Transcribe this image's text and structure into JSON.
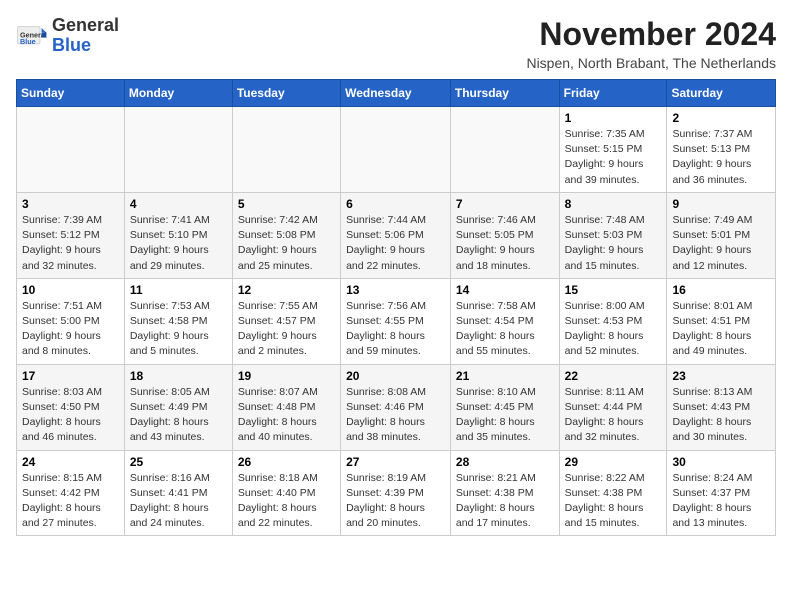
{
  "header": {
    "logo_general": "General",
    "logo_blue": "Blue",
    "month_title": "November 2024",
    "location": "Nispen, North Brabant, The Netherlands"
  },
  "weekdays": [
    "Sunday",
    "Monday",
    "Tuesday",
    "Wednesday",
    "Thursday",
    "Friday",
    "Saturday"
  ],
  "weeks": [
    [
      {
        "day": "",
        "info": ""
      },
      {
        "day": "",
        "info": ""
      },
      {
        "day": "",
        "info": ""
      },
      {
        "day": "",
        "info": ""
      },
      {
        "day": "",
        "info": ""
      },
      {
        "day": "1",
        "info": "Sunrise: 7:35 AM\nSunset: 5:15 PM\nDaylight: 9 hours and 39 minutes."
      },
      {
        "day": "2",
        "info": "Sunrise: 7:37 AM\nSunset: 5:13 PM\nDaylight: 9 hours and 36 minutes."
      }
    ],
    [
      {
        "day": "3",
        "info": "Sunrise: 7:39 AM\nSunset: 5:12 PM\nDaylight: 9 hours and 32 minutes."
      },
      {
        "day": "4",
        "info": "Sunrise: 7:41 AM\nSunset: 5:10 PM\nDaylight: 9 hours and 29 minutes."
      },
      {
        "day": "5",
        "info": "Sunrise: 7:42 AM\nSunset: 5:08 PM\nDaylight: 9 hours and 25 minutes."
      },
      {
        "day": "6",
        "info": "Sunrise: 7:44 AM\nSunset: 5:06 PM\nDaylight: 9 hours and 22 minutes."
      },
      {
        "day": "7",
        "info": "Sunrise: 7:46 AM\nSunset: 5:05 PM\nDaylight: 9 hours and 18 minutes."
      },
      {
        "day": "8",
        "info": "Sunrise: 7:48 AM\nSunset: 5:03 PM\nDaylight: 9 hours and 15 minutes."
      },
      {
        "day": "9",
        "info": "Sunrise: 7:49 AM\nSunset: 5:01 PM\nDaylight: 9 hours and 12 minutes."
      }
    ],
    [
      {
        "day": "10",
        "info": "Sunrise: 7:51 AM\nSunset: 5:00 PM\nDaylight: 9 hours and 8 minutes."
      },
      {
        "day": "11",
        "info": "Sunrise: 7:53 AM\nSunset: 4:58 PM\nDaylight: 9 hours and 5 minutes."
      },
      {
        "day": "12",
        "info": "Sunrise: 7:55 AM\nSunset: 4:57 PM\nDaylight: 9 hours and 2 minutes."
      },
      {
        "day": "13",
        "info": "Sunrise: 7:56 AM\nSunset: 4:55 PM\nDaylight: 8 hours and 59 minutes."
      },
      {
        "day": "14",
        "info": "Sunrise: 7:58 AM\nSunset: 4:54 PM\nDaylight: 8 hours and 55 minutes."
      },
      {
        "day": "15",
        "info": "Sunrise: 8:00 AM\nSunset: 4:53 PM\nDaylight: 8 hours and 52 minutes."
      },
      {
        "day": "16",
        "info": "Sunrise: 8:01 AM\nSunset: 4:51 PM\nDaylight: 8 hours and 49 minutes."
      }
    ],
    [
      {
        "day": "17",
        "info": "Sunrise: 8:03 AM\nSunset: 4:50 PM\nDaylight: 8 hours and 46 minutes."
      },
      {
        "day": "18",
        "info": "Sunrise: 8:05 AM\nSunset: 4:49 PM\nDaylight: 8 hours and 43 minutes."
      },
      {
        "day": "19",
        "info": "Sunrise: 8:07 AM\nSunset: 4:48 PM\nDaylight: 8 hours and 40 minutes."
      },
      {
        "day": "20",
        "info": "Sunrise: 8:08 AM\nSunset: 4:46 PM\nDaylight: 8 hours and 38 minutes."
      },
      {
        "day": "21",
        "info": "Sunrise: 8:10 AM\nSunset: 4:45 PM\nDaylight: 8 hours and 35 minutes."
      },
      {
        "day": "22",
        "info": "Sunrise: 8:11 AM\nSunset: 4:44 PM\nDaylight: 8 hours and 32 minutes."
      },
      {
        "day": "23",
        "info": "Sunrise: 8:13 AM\nSunset: 4:43 PM\nDaylight: 8 hours and 30 minutes."
      }
    ],
    [
      {
        "day": "24",
        "info": "Sunrise: 8:15 AM\nSunset: 4:42 PM\nDaylight: 8 hours and 27 minutes."
      },
      {
        "day": "25",
        "info": "Sunrise: 8:16 AM\nSunset: 4:41 PM\nDaylight: 8 hours and 24 minutes."
      },
      {
        "day": "26",
        "info": "Sunrise: 8:18 AM\nSunset: 4:40 PM\nDaylight: 8 hours and 22 minutes."
      },
      {
        "day": "27",
        "info": "Sunrise: 8:19 AM\nSunset: 4:39 PM\nDaylight: 8 hours and 20 minutes."
      },
      {
        "day": "28",
        "info": "Sunrise: 8:21 AM\nSunset: 4:38 PM\nDaylight: 8 hours and 17 minutes."
      },
      {
        "day": "29",
        "info": "Sunrise: 8:22 AM\nSunset: 4:38 PM\nDaylight: 8 hours and 15 minutes."
      },
      {
        "day": "30",
        "info": "Sunrise: 8:24 AM\nSunset: 4:37 PM\nDaylight: 8 hours and 13 minutes."
      }
    ]
  ]
}
